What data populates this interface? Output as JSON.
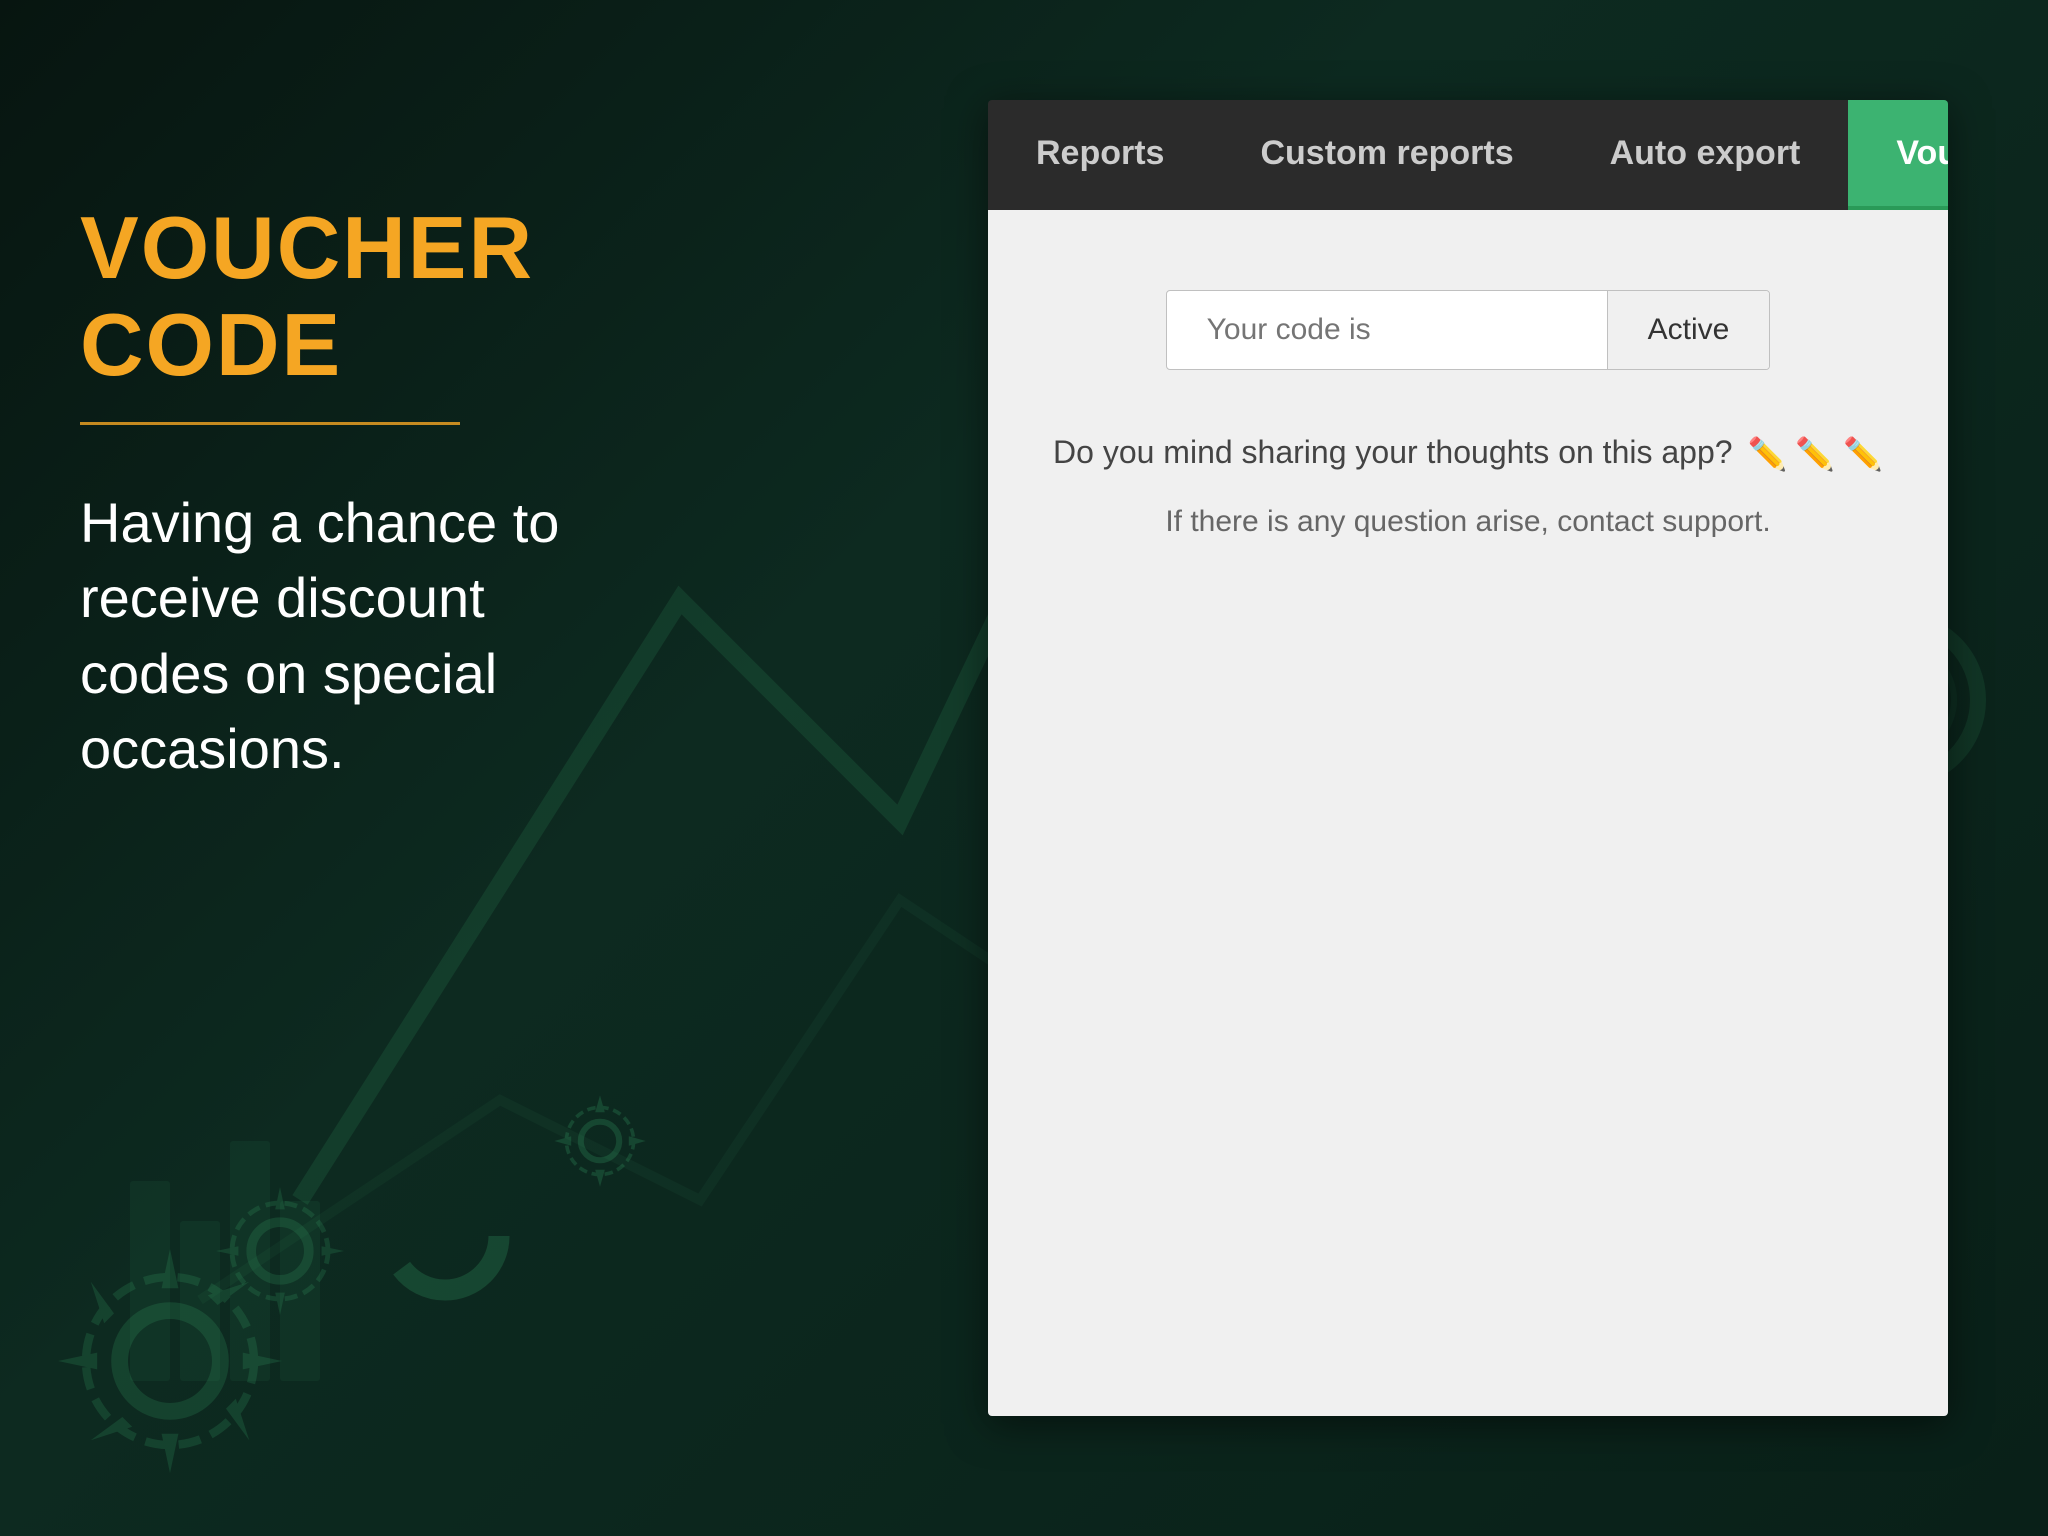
{
  "background": {
    "color": "#0a1f1a"
  },
  "left_panel": {
    "title": "VOUCHER CODE",
    "description": "Having a chance to receive discount codes on special occasions."
  },
  "tabs": [
    {
      "id": "reports",
      "label": "Reports",
      "active": false
    },
    {
      "id": "custom-reports",
      "label": "Custom reports",
      "active": false
    },
    {
      "id": "auto-export",
      "label": "Auto export",
      "active": false
    },
    {
      "id": "voucher",
      "label": "Voucher",
      "active": true
    }
  ],
  "voucher_form": {
    "code_placeholder": "Your code is",
    "active_button_label": "Active",
    "feedback_question": "Do you mind sharing your thoughts on this app?",
    "support_text": "If there is any question arise, contact support."
  }
}
